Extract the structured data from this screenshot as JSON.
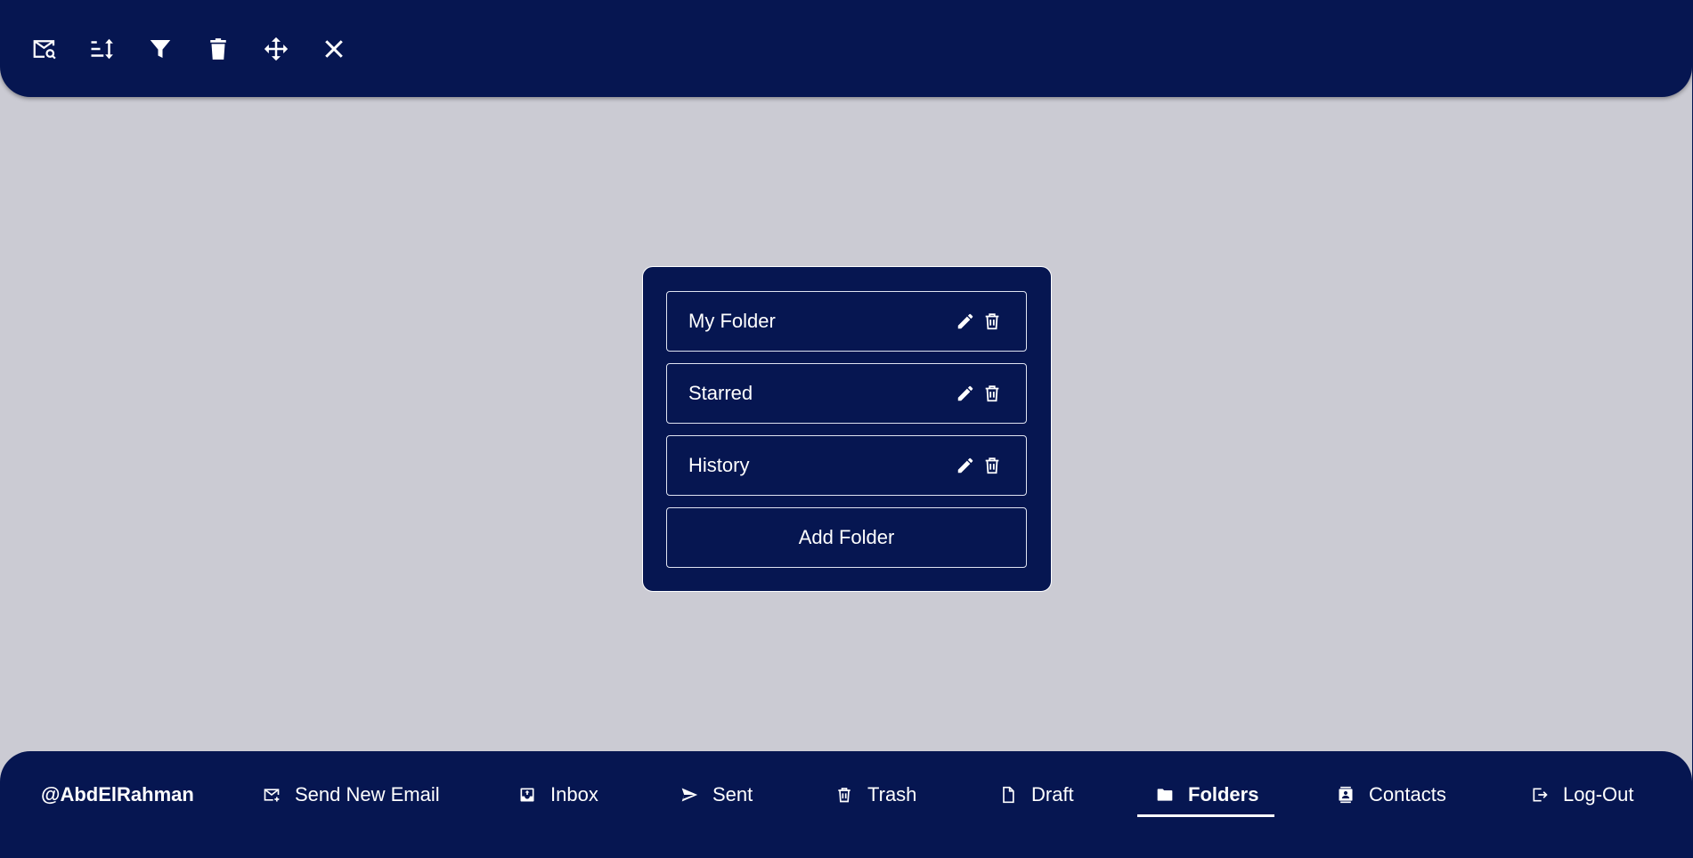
{
  "toolbar": {
    "tools": [
      {
        "name": "search-mail",
        "icon": "mail-search-icon"
      },
      {
        "name": "sort",
        "icon": "sort-icon"
      },
      {
        "name": "filter",
        "icon": "filter-icon"
      },
      {
        "name": "delete",
        "icon": "trash-icon"
      },
      {
        "name": "move",
        "icon": "move-icon"
      },
      {
        "name": "close",
        "icon": "close-icon"
      }
    ]
  },
  "folders": {
    "items": [
      {
        "name": "My Folder"
      },
      {
        "name": "Starred"
      },
      {
        "name": "History"
      }
    ],
    "add_label": "Add Folder"
  },
  "nav": {
    "username": "@AbdElRahman",
    "items": [
      {
        "label": "Send New Email",
        "icon": "send-email-icon"
      },
      {
        "label": "Inbox",
        "icon": "inbox-icon"
      },
      {
        "label": "Sent",
        "icon": "paper-plane-icon"
      },
      {
        "label": "Trash",
        "icon": "trash-icon"
      },
      {
        "label": "Draft",
        "icon": "document-icon"
      },
      {
        "label": "Folders",
        "icon": "folder-icon",
        "active": true
      },
      {
        "label": "Contacts",
        "icon": "contacts-icon"
      },
      {
        "label": "Log-Out",
        "icon": "logout-icon"
      }
    ]
  },
  "colors": {
    "navy": "#061651",
    "background": "#cbcbd3",
    "text": "#ffffff"
  }
}
